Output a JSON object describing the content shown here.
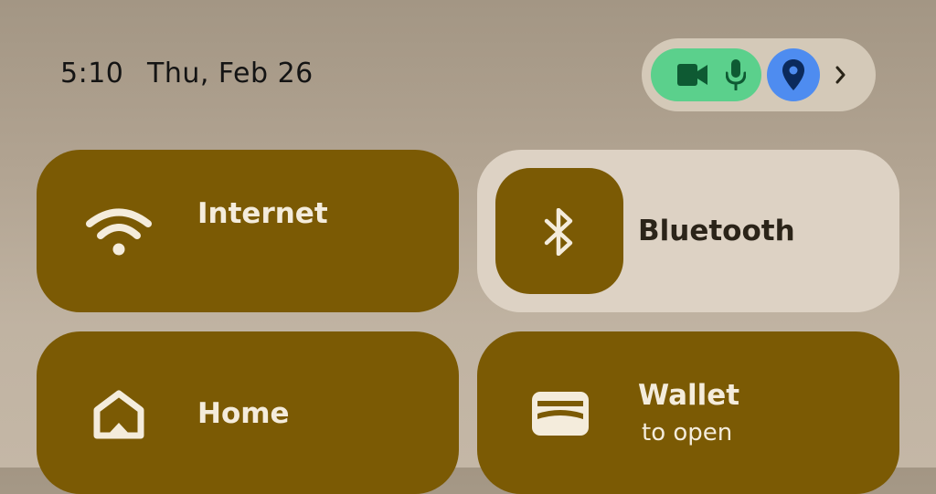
{
  "status_bar": {
    "time": "5:10",
    "date": "Thu, Feb 26"
  },
  "privacy_indicators": {
    "icons": [
      "video-camera-icon",
      "microphone-icon",
      "location-pin-icon",
      "chevron-right-icon"
    ],
    "colors": {
      "camera_mic_chip": "#5bd08c",
      "location_chip": "#4e8cf0",
      "pill_background": "#d4c9b8"
    }
  },
  "tiles": {
    "internet": {
      "label": "Internet",
      "icon": "wifi-icon",
      "active": true
    },
    "bluetooth": {
      "label": "Bluetooth",
      "icon": "bluetooth-icon",
      "active": false
    },
    "home": {
      "label": "Home",
      "icon": "home-icon",
      "active": true
    },
    "wallet": {
      "label": "Wallet",
      "subtitle": "to open",
      "icon": "wallet-icon",
      "active": true
    }
  },
  "colors": {
    "tile_active": "#7b5a04",
    "tile_inactive": "#ddd2c4",
    "tile_text_active": "#f4ecdc",
    "tile_text_inactive": "#2b2419"
  }
}
